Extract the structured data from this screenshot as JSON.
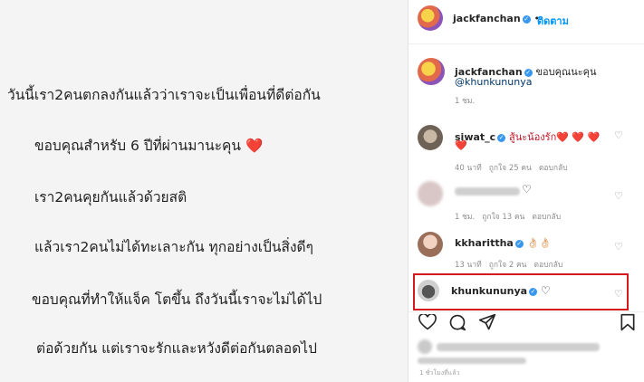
{
  "post": {
    "lines": [
      "วันนี้เรา2คนตกลงกันแล้วว่าเราจะเป็นเพื่อนที่ดีต่อกัน",
      "ขอบคุณสำหรับ 6 ปีที่ผ่านมานะคุน",
      "เรา2คนคุยกันแล้วด้วยสติ",
      "แล้วเรา2คนไม่ได้ทะเลาะกัน ทุกอย่างเป็นสิ่งดีๆ",
      "ขอบคุณที่ทำให้แจ็ค โตขึ้น  ถึงวันนี้เราจะไม่ได้ไป",
      "ต่อด้วยกัน แต่เราจะรักและหวังดีต่อกันตลอดไป"
    ],
    "heart": "❤️"
  },
  "header": {
    "username": "jackfanchan",
    "separator": "•",
    "follow_label": "ติดตาม"
  },
  "caption": {
    "username": "jackfanchan",
    "text": "ขอบคุณนะคุน",
    "mention": "@khunkununya",
    "time": "1 ชม."
  },
  "comments": [
    {
      "username": "siwat_c",
      "text": "สู้นะน้องรัก❤️ ❤️ ❤️",
      "text2": "❤️",
      "time": "40 นาที",
      "likes": "ถูกใจ 25 คน",
      "reply": "ตอบกลับ"
    },
    {
      "username": "",
      "text": "",
      "time": "1 ชม.",
      "likes": "ถูกใจ 13 คน",
      "reply": "ตอบกลับ"
    },
    {
      "username": "kkharittha",
      "text": "👌🏻👌🏻",
      "time": "13 นาที",
      "likes": "ถูกใจ 2 คน",
      "reply": "ตอบกลับ"
    },
    {
      "username": "khunkununya",
      "text": "♡"
    }
  ],
  "footer": {
    "time": "1 ชั่วโมงที่แล้ว"
  },
  "colors": {
    "accent": "#0095f6",
    "highlight": "#d6191f",
    "verified": "#3897f0"
  }
}
